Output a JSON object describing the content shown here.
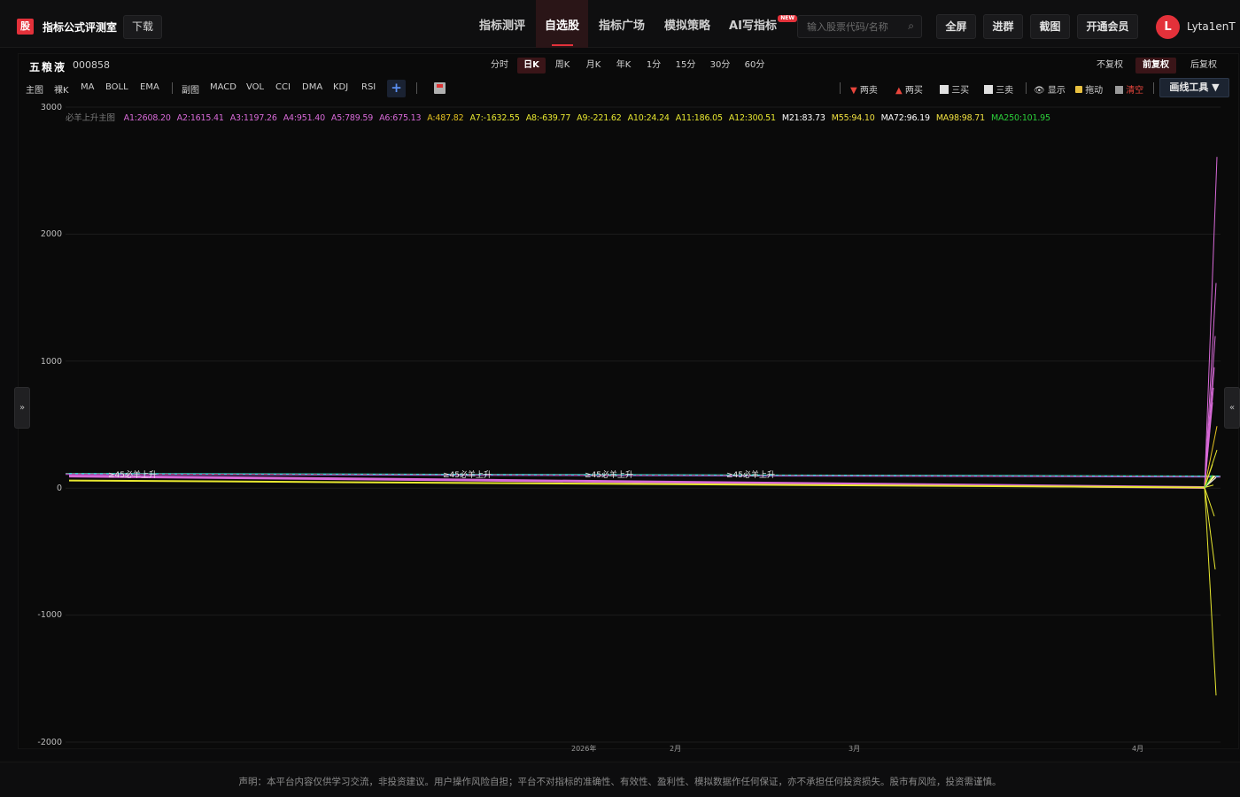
{
  "app": {
    "logo_char": "股",
    "title": "指标公式评测室",
    "download_label": "下载"
  },
  "nav": {
    "items": [
      {
        "label": "指标测评",
        "active": false
      },
      {
        "label": "自选股",
        "active": true
      },
      {
        "label": "指标广场",
        "active": false
      },
      {
        "label": "模拟策略",
        "active": false
      },
      {
        "label": "AI写指标",
        "active": false,
        "badge": "NEW"
      }
    ]
  },
  "search": {
    "placeholder": "输入股票代码/名称"
  },
  "top_buttons": [
    "全屏",
    "进群",
    "截图",
    "开通会员"
  ],
  "user": {
    "avatar_letter": "L",
    "name": "Lyta1enT"
  },
  "stock": {
    "name": "五粮液",
    "code": "000858"
  },
  "periods": {
    "items": [
      "分时",
      "日K",
      "周K",
      "月K",
      "年K",
      "1分",
      "15分",
      "30分",
      "60分"
    ],
    "active": "日K"
  },
  "adjust": {
    "items": [
      "不复权",
      "前复权",
      "后复权"
    ],
    "active": "前复权"
  },
  "main_tools": [
    "主图",
    "裸K",
    "MA",
    "BOLL",
    "EMA"
  ],
  "sub_tools": [
    "副图",
    "MACD",
    "VOL",
    "CCI",
    "DMA",
    "KDJ",
    "RSI"
  ],
  "add_label": "+",
  "draw_tools": [
    {
      "label": "两卖",
      "icon": "down-triangle-icon",
      "color": "#e8453c"
    },
    {
      "label": "两买",
      "icon": "up-triangle-icon",
      "color": "#e8453c"
    },
    {
      "label": "三买",
      "icon": "line-up-icon",
      "color": "#cfcfcf"
    },
    {
      "label": "三卖",
      "icon": "line-down-icon",
      "color": "#cfcfcf"
    },
    {
      "label": "显示",
      "icon": "eye-icon",
      "color": "#cfcfcf"
    },
    {
      "label": "拖动",
      "icon": "lock-icon",
      "color": "#cfcfcf"
    },
    {
      "label": "清空",
      "icon": "trash-icon",
      "color": "#e8453c"
    }
  ],
  "draw_tools_button": "画线工具 ▼",
  "side_toggles": {
    "left": "»",
    "right": "«"
  },
  "indicator": {
    "name": "必羊上升主图",
    "values": [
      {
        "label": "A1:2608.20",
        "color": "#d86ad8"
      },
      {
        "label": "A2:1615.41",
        "color": "#d86ad8"
      },
      {
        "label": "A3:1197.26",
        "color": "#d86ad8"
      },
      {
        "label": "A4:951.40",
        "color": "#d86ad8"
      },
      {
        "label": "A5:789.59",
        "color": "#d86ad8"
      },
      {
        "label": "A6:675.13",
        "color": "#d86ad8"
      },
      {
        "label": "A:487.82",
        "color": "#e3c020"
      },
      {
        "label": "A7:-1632.55",
        "color": "#e8e830"
      },
      {
        "label": "A8:-639.77",
        "color": "#e8e830"
      },
      {
        "label": "A9:-221.62",
        "color": "#e8e830"
      },
      {
        "label": "A10:24.24",
        "color": "#e8e830"
      },
      {
        "label": "A11:186.05",
        "color": "#e8e830"
      },
      {
        "label": "A12:300.51",
        "color": "#e8e830"
      },
      {
        "label": "M21:83.73",
        "color": "#ffffff"
      },
      {
        "label": "M55:94.10",
        "color": "#f0e040"
      },
      {
        "label": "MA72:96.19",
        "color": "#ffffff"
      },
      {
        "label": "MA98:98.71",
        "color": "#f0e040"
      },
      {
        "label": "MA250:101.95",
        "color": "#2ccf3a"
      }
    ],
    "annotation": "≥45必羊上升"
  },
  "chart_data": {
    "type": "line",
    "y_ticks": [
      "3000",
      "2000",
      "1000",
      "0",
      "-1000",
      "-2000"
    ],
    "ylim": [
      -2000,
      3000
    ],
    "x_labels": [
      "2026年",
      "2月",
      "3月",
      "4月"
    ],
    "grid": true,
    "series": [
      {
        "name": "A1",
        "start": 110,
        "end": 2608.2,
        "color": "#d86ad8"
      },
      {
        "name": "A2",
        "start": 110,
        "end": 1615.41,
        "color": "#d86ad8"
      },
      {
        "name": "A3",
        "start": 110,
        "end": 1197.26,
        "color": "#d86ad8"
      },
      {
        "name": "A4",
        "start": 110,
        "end": 951.4,
        "color": "#d86ad8"
      },
      {
        "name": "A5",
        "start": 110,
        "end": 789.59,
        "color": "#d86ad8"
      },
      {
        "name": "A6",
        "start": 110,
        "end": 675.13,
        "color": "#d86ad8"
      },
      {
        "name": "A",
        "start": 110,
        "end": 487.82,
        "color": "#e3c020"
      },
      {
        "name": "A7",
        "start": 100,
        "end": -1632.55,
        "color": "#e8e830"
      },
      {
        "name": "A8",
        "start": 100,
        "end": -639.77,
        "color": "#e8e830"
      },
      {
        "name": "A9",
        "start": 100,
        "end": -221.62,
        "color": "#e8e830"
      },
      {
        "name": "A10",
        "start": 100,
        "end": 24.24,
        "color": "#e8e830"
      },
      {
        "name": "A11",
        "start": 100,
        "end": 186.05,
        "color": "#e8e830"
      },
      {
        "name": "A12",
        "start": 100,
        "end": 300.51,
        "color": "#e8e830"
      },
      {
        "name": "M21",
        "start": 105,
        "end": 83.73,
        "color": "#ffffff"
      },
      {
        "name": "M55",
        "start": 105,
        "end": 94.1,
        "color": "#f0e040"
      },
      {
        "name": "MA72",
        "start": 105,
        "end": 96.19,
        "color": "#ffffff"
      },
      {
        "name": "MA98",
        "start": 105,
        "end": 98.71,
        "color": "#f0e040"
      },
      {
        "name": "MA250",
        "start": 105,
        "end": 101.95,
        "color": "#2ccf3a"
      }
    ]
  },
  "footer": "声明：本平台内容仅供学习交流，非投资建议。用户操作风险自担；平台不对指标的准确性、有效性、盈利性、模拟数据作任何保证，亦不承担任何投资损失。股市有风险，投资需谨慎。"
}
